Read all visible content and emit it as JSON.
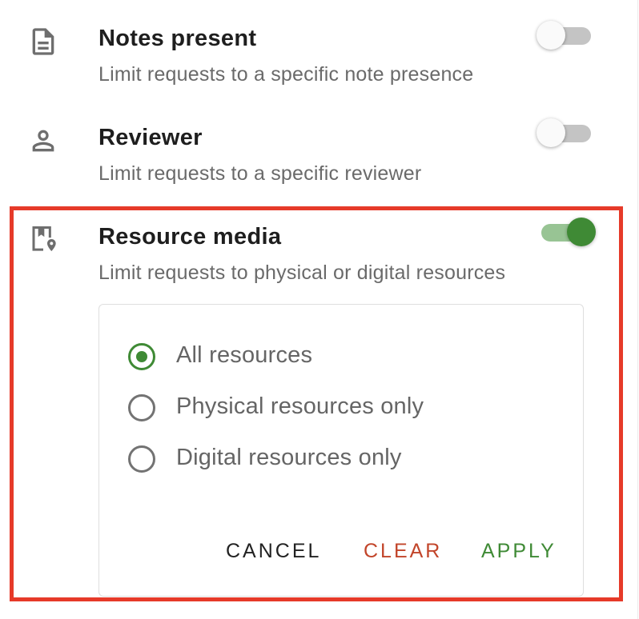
{
  "filters": [
    {
      "icon": "notes-icon",
      "title": "Notes present",
      "description": "Limit requests to a specific note presence",
      "enabled": false
    },
    {
      "icon": "person-icon",
      "title": "Reviewer",
      "description": "Limit requests to a specific reviewer",
      "enabled": false
    },
    {
      "icon": "bookmark-location-icon",
      "title": "Resource media",
      "description": "Limit requests to physical or digital resources",
      "enabled": true
    }
  ],
  "resource_media_options": {
    "choices": [
      {
        "label": "All resources",
        "selected": true
      },
      {
        "label": "Physical resources only",
        "selected": false
      },
      {
        "label": "Digital resources only",
        "selected": false
      }
    ],
    "actions": {
      "cancel_label": "CANCEL",
      "clear_label": "CLEAR",
      "apply_label": "APPLY"
    }
  },
  "colors": {
    "accent_green": "#3f8a35",
    "clear_red": "#c2452a",
    "highlight_red": "#e63a29",
    "toggle_off_track": "#c4c4c4",
    "toggle_on_track": "#98c494",
    "cancel_text": "#222222"
  }
}
